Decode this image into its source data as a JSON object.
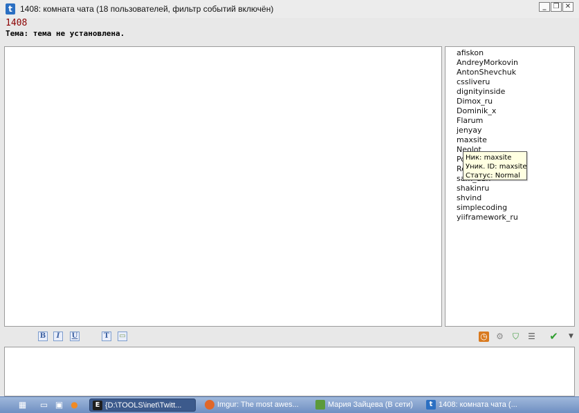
{
  "window": {
    "title": "1408: комната чата (18 пользователей, фильтр событий включён)",
    "minimize": "_",
    "restore": "❐",
    "close": "✕"
  },
  "room": {
    "name": "1408",
    "topic": "Тема: тема не установлена."
  },
  "users": [
    "afiskon",
    "AndreyMorkovin",
    "AntonShevchuk",
    "cssliveru",
    "dignityinside",
    "Dimox_ru",
    "Dominik_x",
    "Flarum",
    "jenyay",
    "maxsite",
    "Neolot",
    "Po",
    "Re",
    "sam_dan",
    "shakinru",
    "shvind",
    "simplecoding",
    "yiiframework_ru"
  ],
  "tooltip": {
    "line1": "Ник: maxsite",
    "line2": "Уник. ID: maxsite",
    "line3": "Статус: Normal"
  },
  "toolbar": {
    "bold": "B",
    "italic": "I",
    "underline": "U",
    "text": "T",
    "image": "▭",
    "clock_icon": "clock-icon",
    "settings_icon": "gear-icon",
    "status_icon": "shield-check-icon",
    "list_icon": "list-icon",
    "send_icon": "checkmark-icon",
    "dropdown_icon": "chevron-down-icon"
  },
  "taskbar": {
    "tasks": [
      "{D:\\TOOLS\\inet\\Twitt...",
      "Imgur: The most awes...",
      "Мария Зайцева (В сети)",
      "1408: комната чата (..."
    ]
  },
  "colors": {
    "room_name": "#8b0000",
    "send_check": "#2f9e2f",
    "taskbar": "#7f9dcc"
  }
}
